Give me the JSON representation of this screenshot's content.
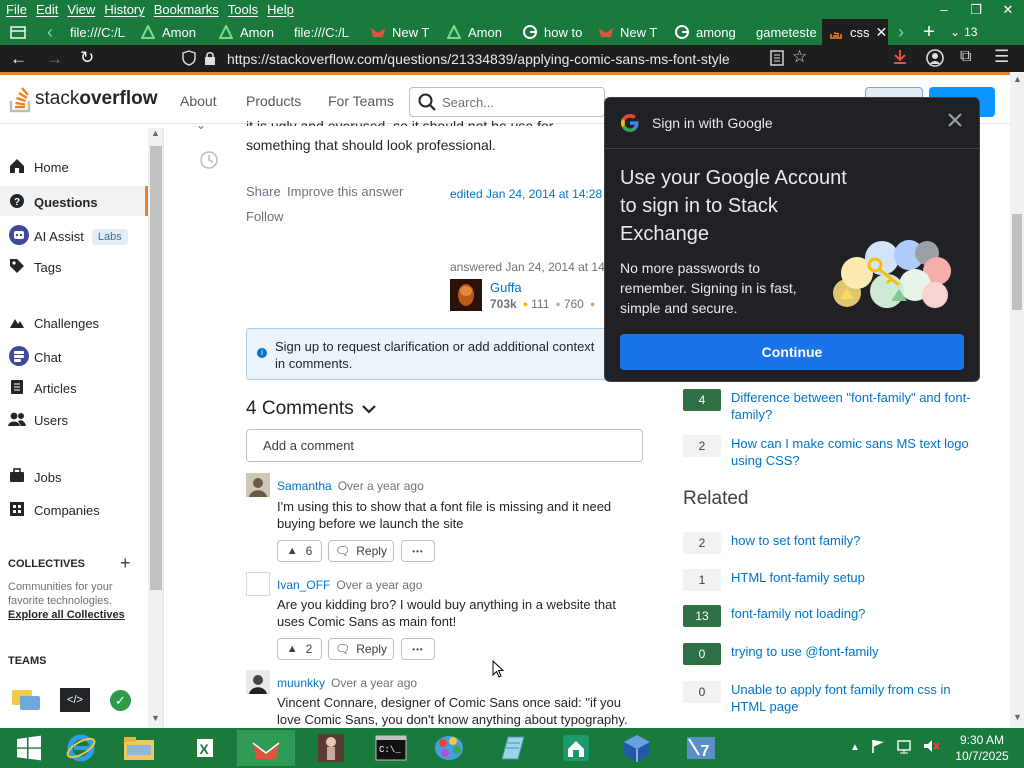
{
  "browser": {
    "menu": [
      "File",
      "Edit",
      "View",
      "History",
      "Bookmarks",
      "Tools",
      "Help"
    ],
    "window_controls": [
      "–",
      "❐",
      "✕"
    ],
    "tabs": [
      {
        "label": "file:///C:/L",
        "icon": "file"
      },
      {
        "label": "Amon",
        "icon": "among"
      },
      {
        "label": "Amon",
        "icon": "among"
      },
      {
        "label": "file:///C:/L",
        "icon": "file"
      },
      {
        "label": "New T",
        "icon": "newtab"
      },
      {
        "label": "Amon",
        "icon": "among"
      },
      {
        "label": "how to",
        "icon": "google"
      },
      {
        "label": "New T",
        "icon": "newtab"
      },
      {
        "label": "among",
        "icon": "google"
      },
      {
        "label": "gameteste",
        "icon": "none"
      },
      {
        "label": "css",
        "icon": "so"
      }
    ],
    "tab_count": "13",
    "url": "https://stackoverflow.com/questions/21334839/applying-comic-sans-ms-font-style"
  },
  "so_header": {
    "logo_a": "stack",
    "logo_b": "overflow",
    "nav": [
      "About",
      "Products",
      "For Teams"
    ],
    "search_placeholder": "Search..."
  },
  "sidebar": {
    "items": [
      {
        "label": "Home",
        "icon": "home"
      },
      {
        "label": "Questions",
        "icon": "questions"
      },
      {
        "label": "AI Assist",
        "icon": "ai-assist",
        "badge": "Labs"
      },
      {
        "label": "Tags",
        "icon": "tag"
      },
      {
        "label": "Challenges",
        "icon": "challenges"
      },
      {
        "label": "Chat",
        "icon": "chat"
      },
      {
        "label": "Articles",
        "icon": "articles"
      },
      {
        "label": "Users",
        "icon": "users"
      },
      {
        "label": "Jobs",
        "icon": "jobs"
      },
      {
        "label": "Companies",
        "icon": "companies"
      }
    ],
    "collectives_title": "COLLECTIVES",
    "collectives_text": "Communities for your favorite technologies.",
    "collectives_link": "Explore all Collectives",
    "teams_title": "TEAMS"
  },
  "answer": {
    "text_partial": "it is ugly and overused, so it should not be use for",
    "text_line2": "something that should look professional.",
    "share": "Share",
    "improve": "Improve this answer",
    "follow": "Follow",
    "edited": "edited Jan 24, 2014 at 14:28",
    "answered": "answered Jan 24, 2014 at 14:2",
    "user": "Guffa",
    "rep": "703k",
    "gold": "111",
    "silver": "760"
  },
  "notice": "Sign up to request clarification or add additional context in comments.",
  "comments": {
    "heading": "4 Comments",
    "add_placeholder": "Add a comment",
    "items": [
      {
        "user": "Samantha",
        "date": "Over a year ago",
        "text": "I'm using this to show that a font file is missing and it need buying before we launch the site",
        "votes": "6",
        "reply": "Reply",
        "more": "•••"
      },
      {
        "user": "Ivan_OFF",
        "date": "Over a year ago",
        "text": "Are you kidding bro? I would buy anything in a website that uses Comic Sans as main font!",
        "votes": "2",
        "reply": "Reply",
        "more": "•••"
      },
      {
        "user": "muunkky",
        "date": "Over a year ago",
        "text": "Vincent Connare, designer of Comic Sans once said: \"if you love Comic Sans, you don't know anything about typography."
      }
    ]
  },
  "linked": [
    {
      "score": "4",
      "accepted": true,
      "title": "Difference between \"font-family\" and font-family?"
    },
    {
      "score": "2",
      "accepted": false,
      "title": "How can I make comic sans MS text logo using CSS?"
    }
  ],
  "related": {
    "heading": "Related",
    "items": [
      {
        "score": "2",
        "accepted": false,
        "title": "how to set font family?"
      },
      {
        "score": "1",
        "accepted": false,
        "title": "HTML font-family setup"
      },
      {
        "score": "13",
        "accepted": true,
        "title": "font-family not loading?"
      },
      {
        "score": "0",
        "accepted": true,
        "title": "trying to use @font-family"
      },
      {
        "score": "0",
        "accepted": false,
        "title": "Unable to apply font family from css in HTML page"
      }
    ]
  },
  "google_popup": {
    "title": "Sign in with Google",
    "heading": "Use your Google Account to sign in to Stack Exchange",
    "body": "No more passwords to remember. Signing in is fast, simple and secure.",
    "button": "Continue"
  },
  "taskbar": {
    "time": "9:30 AM",
    "date": "10/7/2025"
  },
  "colors": {
    "accent": "#1a7a3d",
    "so_orange": "#f48024",
    "link": "#0074cc",
    "google_blue": "#1a73e8"
  }
}
